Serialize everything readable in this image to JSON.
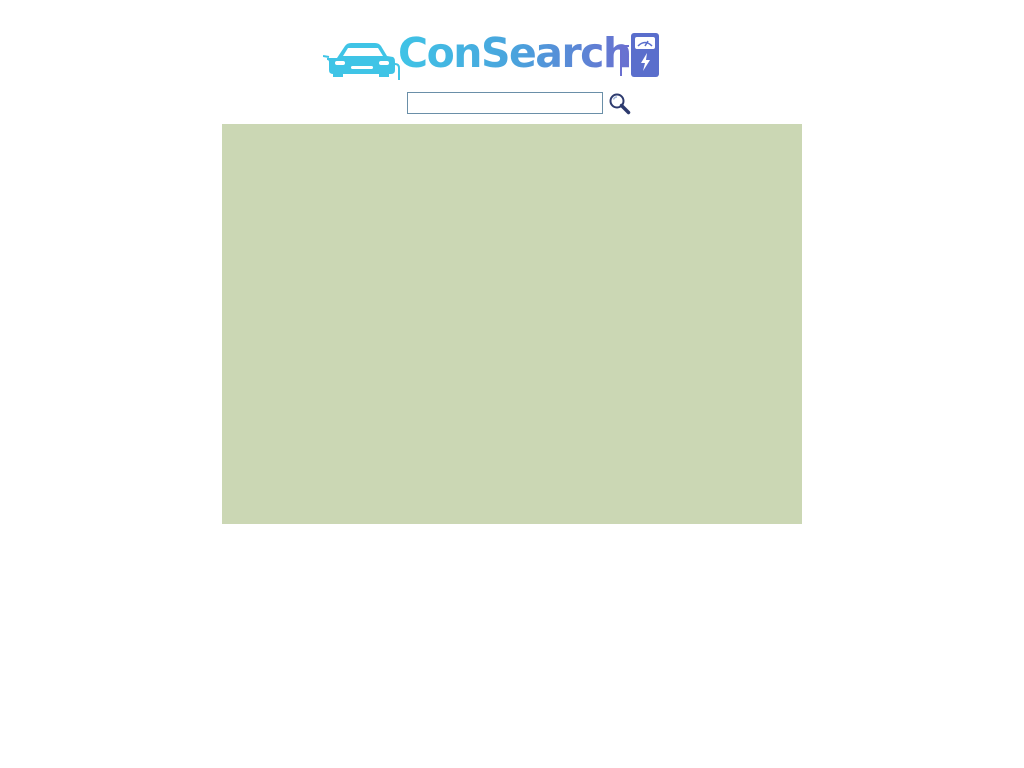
{
  "brand": {
    "name": "ConSearch",
    "logo_icons": [
      "car-icon",
      "charging-station-icon"
    ],
    "gradient_colors": [
      "#3fc4e6",
      "#4aa3dd",
      "#6a6fd0"
    ]
  },
  "search": {
    "value": "",
    "placeholder": "",
    "button_icon": "magnifier-icon"
  },
  "content": {
    "background_color": "#cbd7b4"
  }
}
